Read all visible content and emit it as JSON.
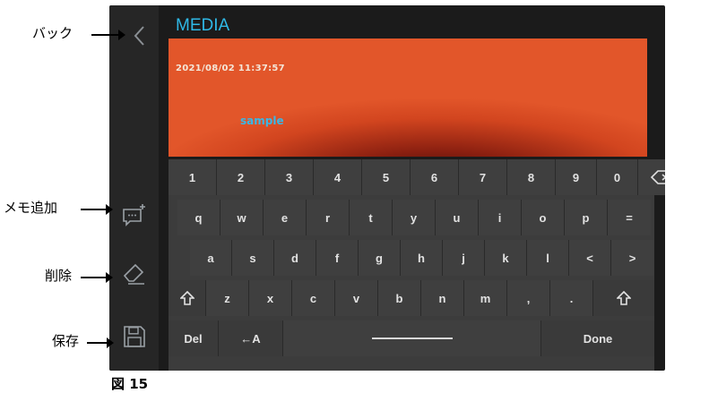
{
  "screen": {
    "title": "MEDIA",
    "timestamp": "2021/08/02 11:37:57",
    "memo_text": "sample"
  },
  "keyboard": {
    "row1": [
      "1",
      "2",
      "3",
      "4",
      "5",
      "6",
      "7",
      "8",
      "9",
      "0"
    ],
    "row2": [
      "q",
      "w",
      "e",
      "r",
      "t",
      "y",
      "u",
      "i",
      "o",
      "p",
      "="
    ],
    "row3": [
      "a",
      "s",
      "d",
      "f",
      "g",
      "h",
      "j",
      "k",
      "l",
      "<",
      ">"
    ],
    "row4": [
      "z",
      "x",
      "c",
      "v",
      "b",
      "n",
      "m",
      ",",
      "."
    ],
    "del_label": "Del",
    "caps_label": "←A",
    "done_label": "Done",
    "backspace_icon": "backspace-icon",
    "shift_icon": "shift-icon"
  },
  "callouts": {
    "back": "バック",
    "add_memo": "メモ追加",
    "delete": "削除",
    "save": "保存"
  },
  "figure_caption": "図 15",
  "colors": {
    "title": "#2fb8e6",
    "memo_text": "#3ab7e6",
    "media_background": "#d2451f",
    "panel": "#262626",
    "keyboard": "#3c3c3c"
  }
}
